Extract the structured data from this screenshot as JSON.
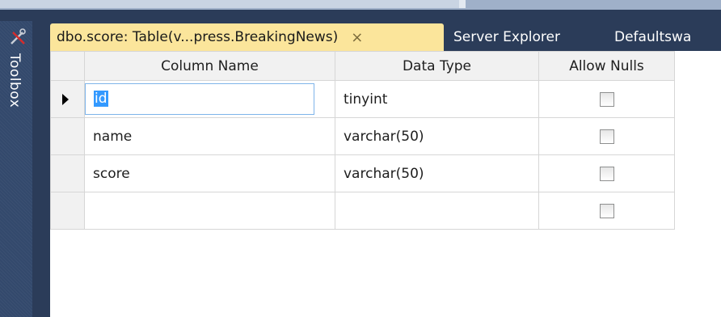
{
  "toolbox": {
    "label": "Toolbox"
  },
  "tabs": {
    "active": {
      "title": "dbo.score: Table(v...press.BreakingNews)",
      "close": "×"
    },
    "inactive": [
      {
        "title": "Server Explorer"
      },
      {
        "title": "Defaultswa"
      }
    ]
  },
  "grid": {
    "headers": {
      "column_name": "Column Name",
      "data_type": "Data Type",
      "allow_nulls": "Allow Nulls"
    },
    "rows": [
      {
        "name": "id",
        "type": "tinyint",
        "allow_nulls": false,
        "selected": true
      },
      {
        "name": "name",
        "type": "varchar(50)",
        "allow_nulls": false
      },
      {
        "name": "score",
        "type": "varchar(50)",
        "allow_nulls": false
      },
      {
        "name": "",
        "type": "",
        "allow_nulls": false
      }
    ]
  },
  "colors": {
    "background": "#2b3c59",
    "active_tab": "#fbe59b",
    "selection": "#3399ff",
    "toolbox": "#33496c"
  }
}
